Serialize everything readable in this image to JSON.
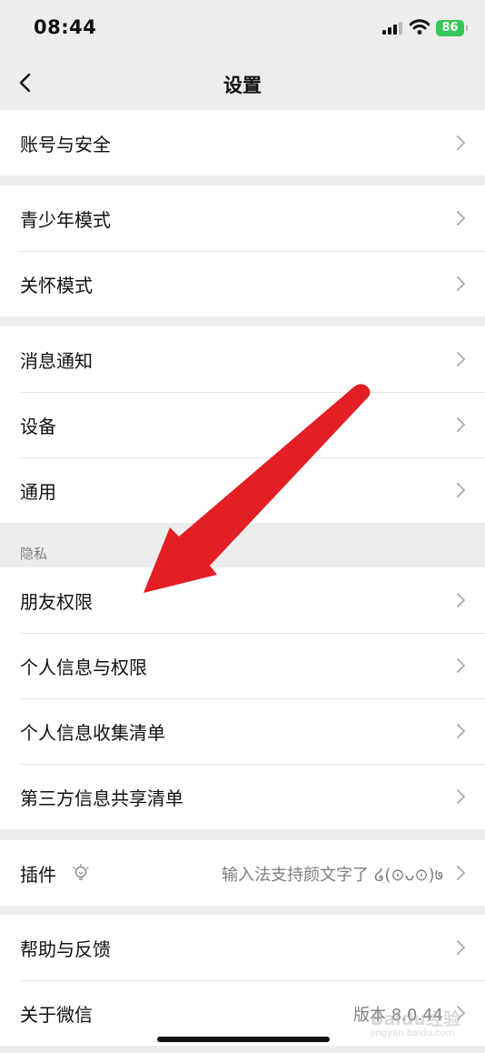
{
  "status_bar": {
    "time": "08:44",
    "battery": "86"
  },
  "nav": {
    "title": "设置"
  },
  "groups": {
    "account": {
      "items": [
        {
          "label": "账号与安全"
        }
      ]
    },
    "modes": {
      "items": [
        {
          "label": "青少年模式"
        },
        {
          "label": "关怀模式"
        }
      ]
    },
    "general": {
      "items": [
        {
          "label": "消息通知"
        },
        {
          "label": "设备"
        },
        {
          "label": "通用"
        }
      ]
    },
    "privacy": {
      "header": "隐私",
      "items": [
        {
          "label": "朋友权限"
        },
        {
          "label": "个人信息与权限"
        },
        {
          "label": "个人信息收集清单"
        },
        {
          "label": "第三方信息共享清单"
        }
      ]
    },
    "plugins": {
      "items": [
        {
          "label": "插件",
          "value": "输入法支持颜文字了 ໒(⊙ᴗ⊙)७",
          "icon": "lightbulb-icon"
        }
      ]
    },
    "about": {
      "items": [
        {
          "label": "帮助与反馈"
        },
        {
          "label": "关于微信",
          "value": "版本 8.0.44"
        }
      ]
    }
  },
  "annotation": {
    "type": "red-arrow",
    "color": "#e41e25",
    "target": "朋友权限"
  },
  "watermark": {
    "text": "Baidu经验",
    "sub": "jingyan.baidu.com"
  }
}
